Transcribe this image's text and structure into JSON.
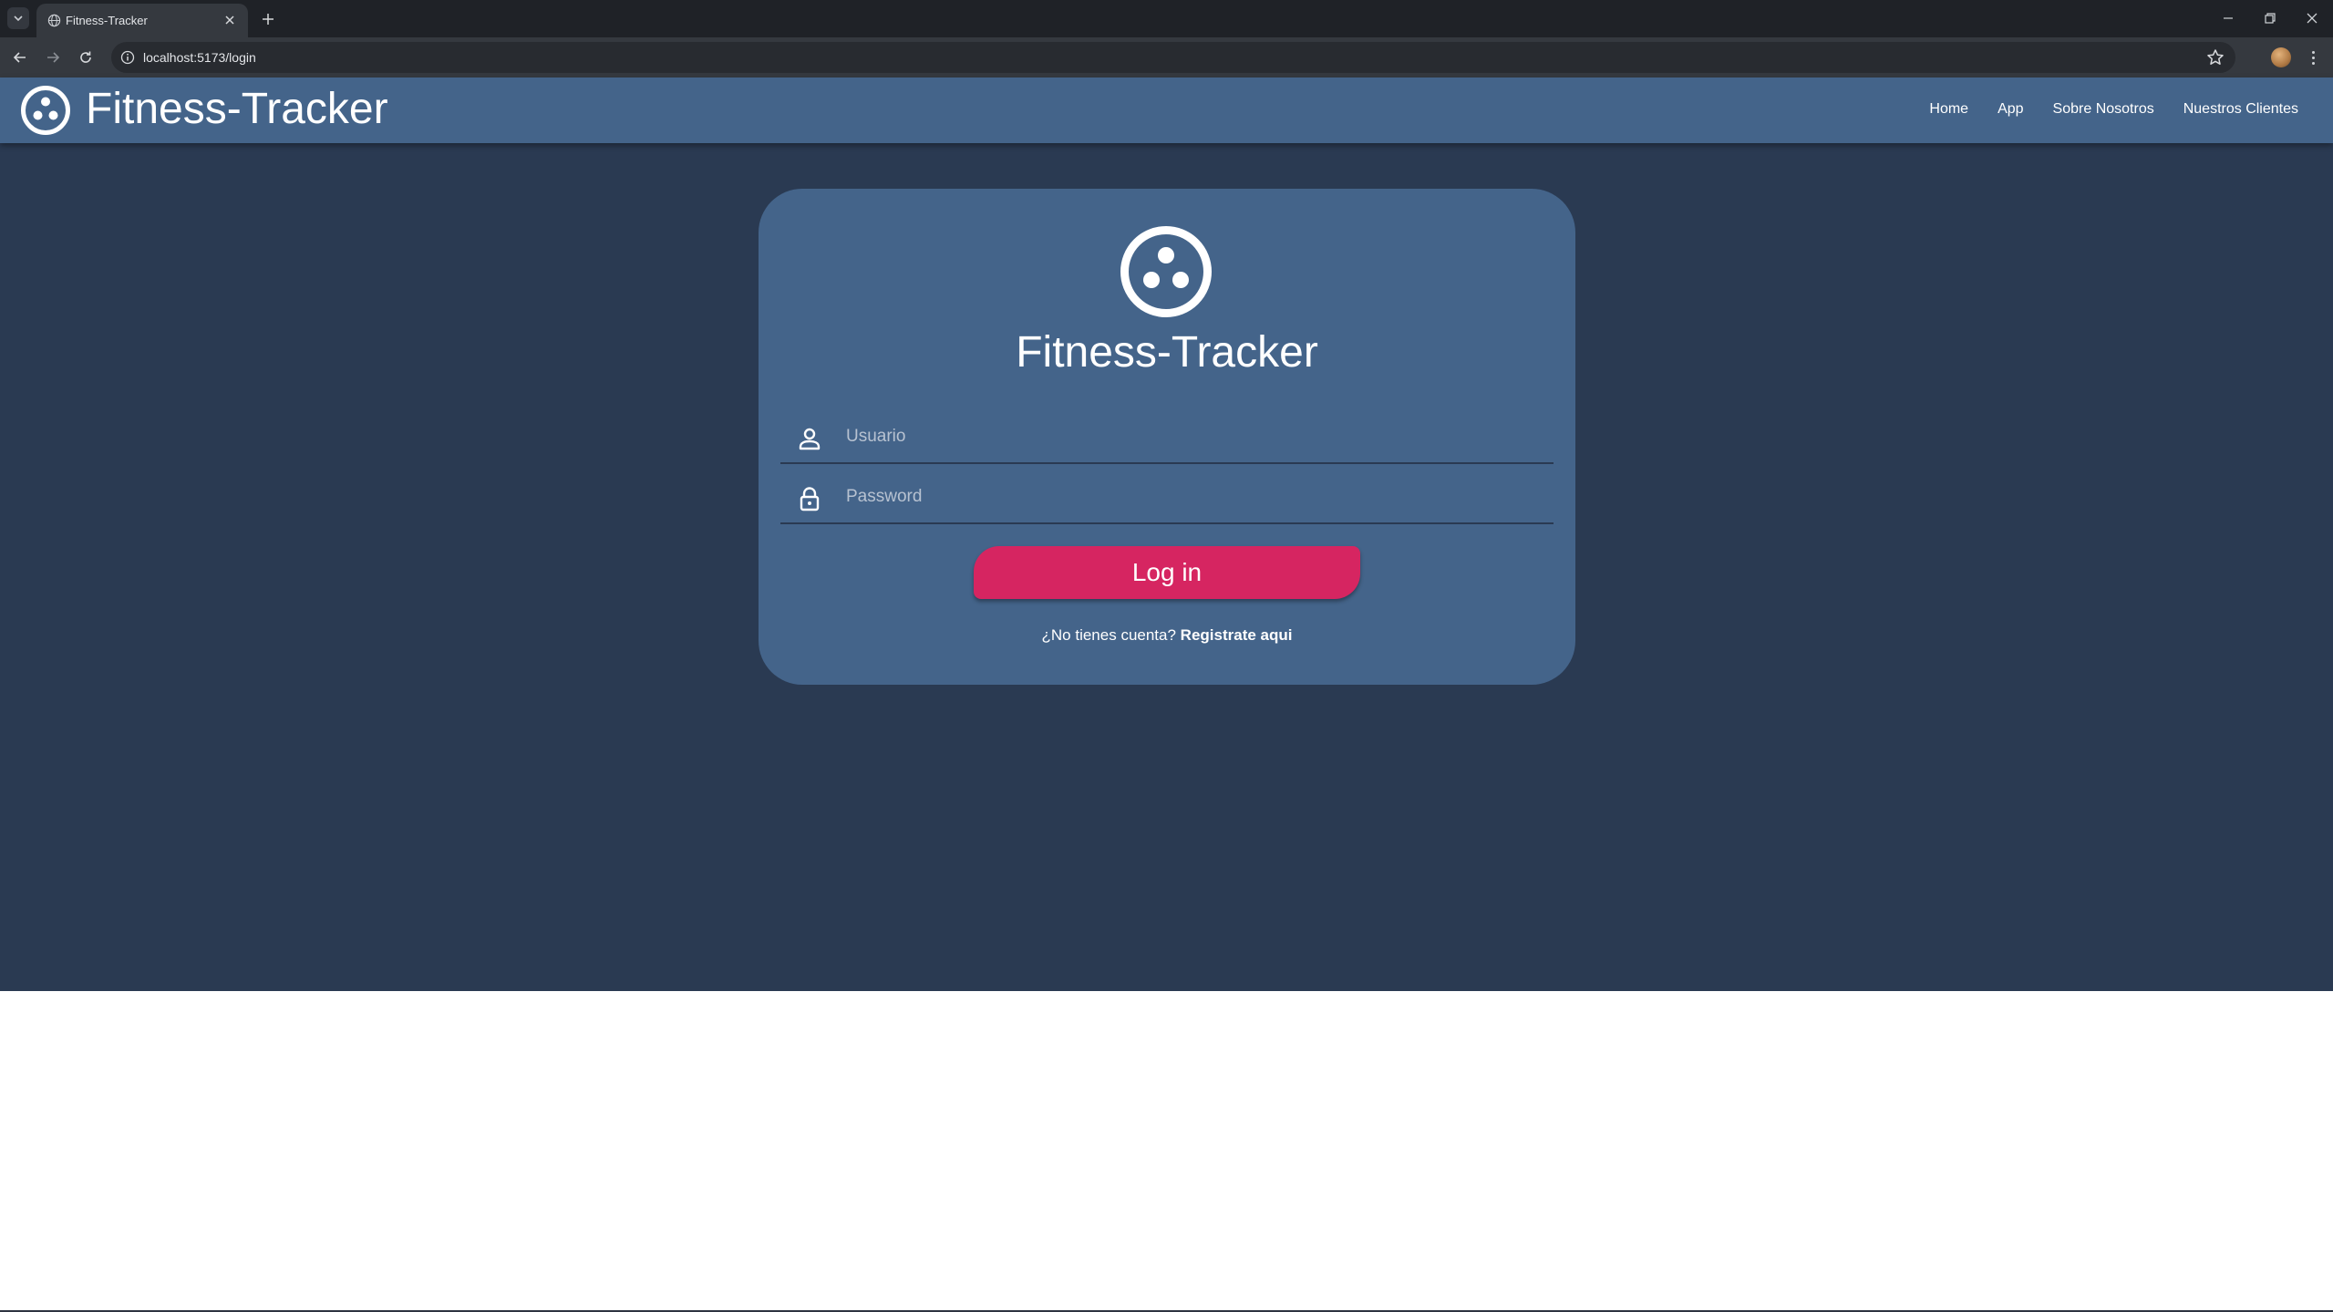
{
  "browser": {
    "tab": {
      "title": "Fitness-Tracker"
    },
    "address_bar": {
      "url": "localhost:5173/login"
    }
  },
  "navbar": {
    "brand": "Fitness-Tracker",
    "links": [
      "Home",
      "App",
      "Sobre Nosotros",
      "Nuestros Clientes"
    ]
  },
  "login": {
    "title": "Fitness-Tracker",
    "username": {
      "placeholder": "Usuario",
      "value": ""
    },
    "password": {
      "placeholder": "Password",
      "value": ""
    },
    "submit_label": "Log in",
    "signup_prompt": "¿No tienes cuenta?",
    "signup_link": "Registrate aqui"
  },
  "colors": {
    "page_background": "#2a3a52",
    "navbar": "#44648a",
    "card": "#44648a",
    "primary_button": "#d62561",
    "text": "#ffffff"
  },
  "icons": [
    "globe-icon",
    "close-icon",
    "plus-icon",
    "back-arrow-icon",
    "forward-arrow-icon",
    "reload-icon",
    "site-info-icon",
    "star-icon",
    "fitness-logo-icon",
    "user-icon",
    "lock-icon"
  ]
}
